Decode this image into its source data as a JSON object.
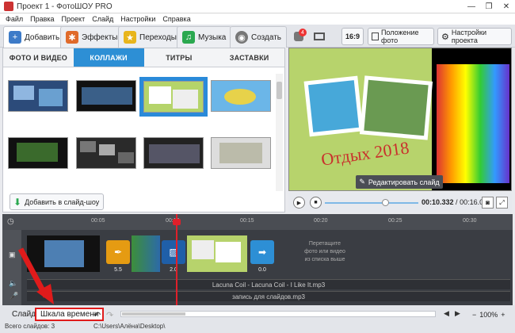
{
  "window": {
    "title": "Проект 1 - ФотоШОУ PRO",
    "controls": [
      "—",
      "❐",
      "✕"
    ]
  },
  "menu": [
    "Файл",
    "Правка",
    "Проект",
    "Слайд",
    "Настройки",
    "Справка"
  ],
  "tabs": [
    {
      "label": "Добавить",
      "icon": "add-icon",
      "color": "#3d7bc8"
    },
    {
      "label": "Эффекты",
      "icon": "effects-icon",
      "color": "#e06a2a"
    },
    {
      "label": "Переходы",
      "icon": "star-icon",
      "color": "#e8b51c"
    },
    {
      "label": "Музыка",
      "icon": "music-icon",
      "color": "#2aa84f"
    },
    {
      "label": "Создать",
      "icon": "film-icon",
      "color": "#777"
    }
  ],
  "right_toolbar": {
    "badge_count": "4",
    "aspect": "16:9",
    "photo_position": "Положение фото",
    "project_settings": "Настройки проекта"
  },
  "subtabs": [
    "ФОТО И ВИДЕО",
    "КОЛЛАЖИ",
    "ТИТРЫ",
    "ЗАСТАВКИ"
  ],
  "add_to_show": "Добавить в слайд-шоу",
  "preview": {
    "caption": "Отдых 2018",
    "edit_slide": "Редактировать слайд"
  },
  "player": {
    "current": "00:10.332",
    "total": "00:16.000"
  },
  "ruler_ticks": [
    "00:05",
    "00:10",
    "00:15",
    "00:20",
    "00:25",
    "00:30"
  ],
  "transitions": [
    {
      "duration": "5.5"
    },
    {
      "duration": "2.0"
    },
    {
      "duration": "0.0"
    }
  ],
  "dropzone_text": [
    "Перетащите",
    "фото или видео",
    "из списка выше"
  ],
  "audio_tracks": [
    "Lacuna Coil - Lacuna Coil - I Like It.mp3",
    "запись для слайдов.mp3"
  ],
  "view_tabs": [
    "Слайды",
    "Шкала времени"
  ],
  "status": {
    "total_slides": "Всего слайдов: 3",
    "path": "C:\\Users\\Алёна\\Desktop\\",
    "zoom": "100%"
  },
  "colors": {
    "accent": "#2d8fd5",
    "highlight": "#e01b1b"
  }
}
